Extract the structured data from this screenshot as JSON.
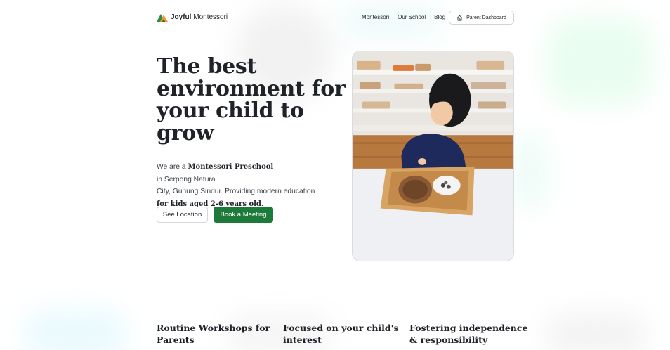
{
  "header": {
    "logo_bold": "Joyful",
    "logo_rest": "Montessori",
    "nav": [
      "Montessori",
      "Our School",
      "Blog"
    ],
    "dashboard_label": "Parent Dashboard"
  },
  "hero": {
    "title_lines": [
      "The best",
      "environment for",
      "your child to",
      "grow"
    ],
    "desc": {
      "part1": "We are a",
      "bold1": "Montessori Preschool",
      "part2": "in Serpong Natura",
      "line2": "City, Gunung Sindur. Providing modern education",
      "bold2": "for kids aged 2-6 years old."
    },
    "buttons": {
      "location": "See Location",
      "meeting": "Book a Meeting"
    }
  },
  "features": [
    {
      "line1": "Routine Workshops for",
      "line2": "Parents"
    },
    {
      "line1": "Focused on your child's",
      "line2": "interest"
    },
    {
      "line1": "Fostering independence",
      "line2": "& responsibility"
    }
  ],
  "colors": {
    "primary": "#1e7a3b",
    "text": "#1f2328",
    "logo_orange": "#f29a2e",
    "logo_green": "#2e8b4a"
  },
  "icons": {
    "dashboard": "home-icon",
    "logo": "mountain-logo-icon"
  }
}
